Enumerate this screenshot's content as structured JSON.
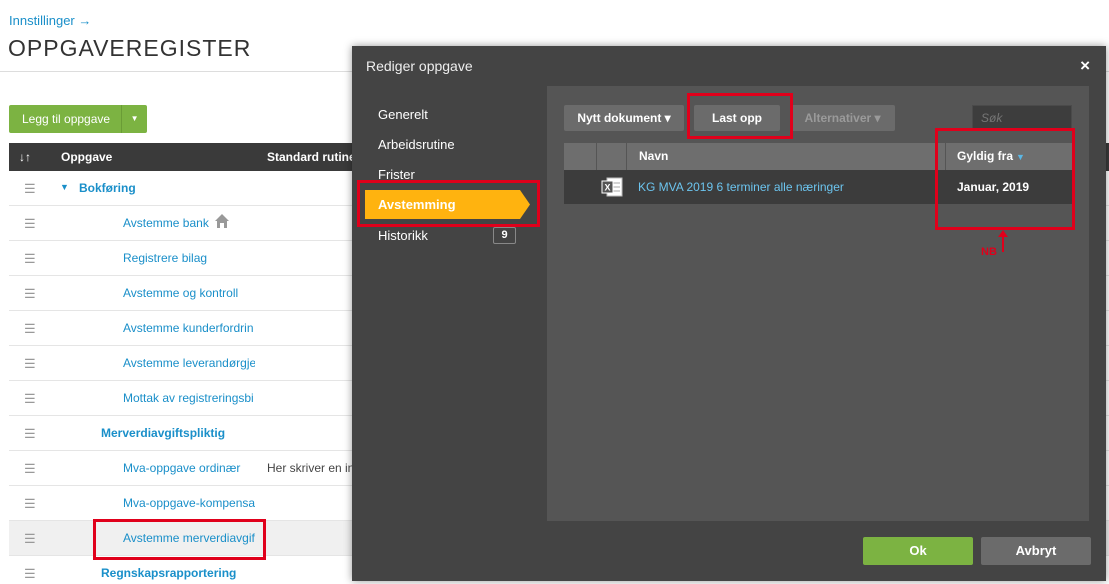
{
  "page": {
    "breadcrumb": "Innstillinger →",
    "title": "OPPGAVEREGISTER",
    "add_button": "Legg til oppgave",
    "columns": {
      "sort": "↓↑",
      "task": "Oppgave",
      "routine": "Standard rutine"
    },
    "rows": [
      {
        "label": "Bokføring",
        "desc": ""
      },
      {
        "label": "Avstemme bank",
        "desc": ""
      },
      {
        "label": "Registrere bilag",
        "desc": ""
      },
      {
        "label": "Avstemme og kontroll",
        "desc": ""
      },
      {
        "label": "Avstemme kunderfordrin",
        "desc": ""
      },
      {
        "label": "Avstemme leverandørgje",
        "desc": ""
      },
      {
        "label": "Mottak av registreringsbi",
        "desc": ""
      },
      {
        "label": "Merverdiavgiftspliktig",
        "desc": ""
      },
      {
        "label": "Mva-oppgave ordinær",
        "desc": "Her skriver en in"
      },
      {
        "label": "Mva-oppgave-kompensa",
        "desc": ""
      },
      {
        "label": "Avstemme merverdiavgif",
        "desc": ""
      },
      {
        "label": "Regnskapsrapportering",
        "desc": ""
      }
    ]
  },
  "modal": {
    "title": "Rediger oppgave",
    "close": "×",
    "sidebar": {
      "items": [
        "Generelt",
        "Arbeidsrutine",
        "Frister",
        "Avstemming",
        "Historikk"
      ],
      "history_count": "9"
    },
    "toolbar": {
      "new_document": "Nytt dokument ▾",
      "upload": "Last opp",
      "alternatives": "Alternativer ▾",
      "search_placeholder": "Søk"
    },
    "grid": {
      "col_name": "Navn",
      "col_valid_from": "Gyldig fra",
      "sort_arrow": "▼",
      "rows": [
        {
          "name": "KG MVA 2019 6 terminer alle næringer",
          "valid_from": "Januar, 2019",
          "icon": "excel-icon"
        }
      ]
    },
    "annotation": "NB",
    "ok": "Ok",
    "cancel": "Avbryt"
  },
  "colors": {
    "accent": "#ffb30f",
    "green": "#7cb342",
    "link": "#1a8fc9",
    "highlight": "#e0001b"
  }
}
